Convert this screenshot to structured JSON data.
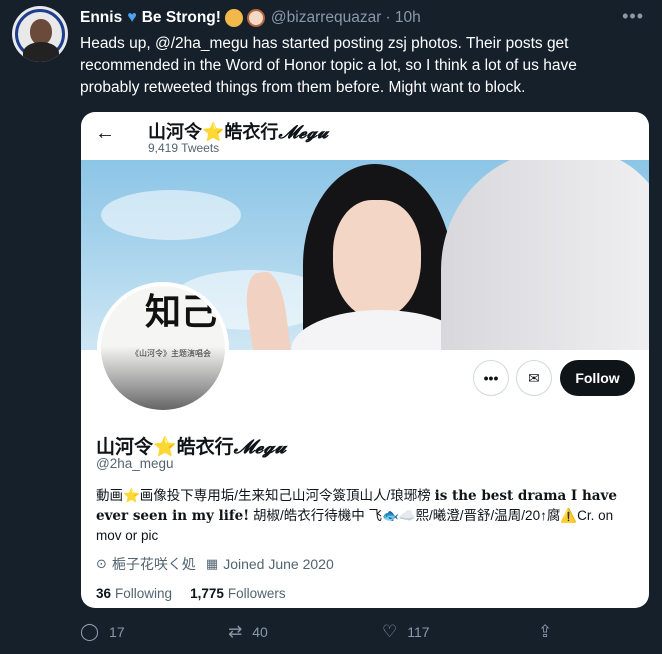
{
  "tweet": {
    "author_name": "Ennis",
    "author_suffix": "Be Strong!",
    "handle": "@bizarrequazar",
    "time": "· 10h",
    "text": "Heads up, @/2ha_megu has started posting zsj photos. Their posts get recommended in the Word of Honor topic a lot, so I think a lot of us have probably retweeted things from them before. Might want to block.",
    "icons": [
      "blue-heart-icon",
      "cat-face-icon",
      "dog-face-icon",
      "more-icon"
    ]
  },
  "screenshot": {
    "profile_title": "山河令",
    "profile_title_star": "⭐",
    "profile_title_b": "皓衣行",
    "profile_title_latin": "𝓜𝓮𝓰𝓾",
    "tweet_count": "9,419 Tweets",
    "avatar_caption": "《山河令》主题演唱会",
    "avatar_glyph": "知己",
    "follow_label": "Follow",
    "name": "山河令⭐皓衣行",
    "name_latin": "𝓜𝓮𝓰𝓾",
    "handle": "@2ha_megu",
    "bio_a": "動画⭐画像投下専用垢/生来知己山河令簽頂山人/琅琊榜 ",
    "bio_b": "𝐢𝐬 𝐭𝐡𝐞 𝐛𝐞𝐬𝐭 𝐝𝐫𝐚𝐦𝐚 𝐈 𝐡𝐚𝐯𝐞 𝐞𝐯𝐞𝐫 𝐬𝐞𝐞𝐧 𝐢𝐧 𝐦𝐲 𝐥𝐢𝐟𝐞!",
    "bio_c": " 胡椒/皓衣行待機中 飞🐟☁️熙/曦澄/晋舒/温周/20↑腐⚠️Cr. on mov or pic",
    "location": "梔子花咲く処",
    "joined": "Joined June 2020",
    "following_count": "36",
    "following_label": "Following",
    "followers_count": "1,775",
    "followers_label": "Followers"
  },
  "actions": {
    "replies": "17",
    "retweets": "40",
    "likes": "117"
  }
}
